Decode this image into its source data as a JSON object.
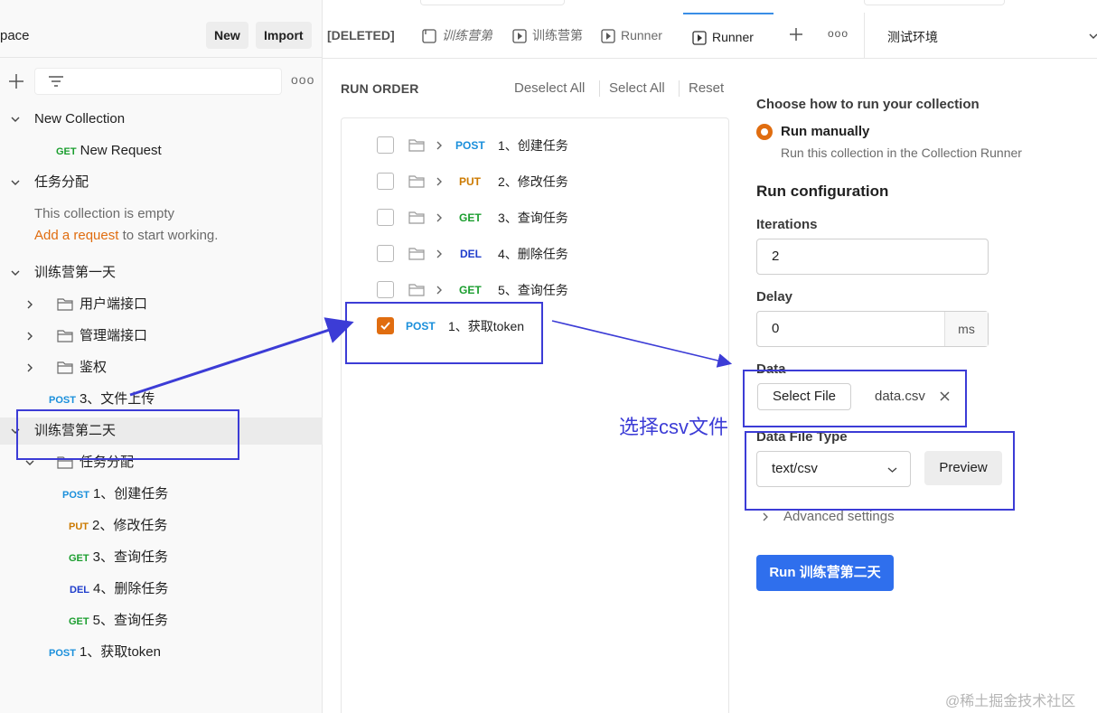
{
  "sidebar": {
    "workspace_name": "pace",
    "new_label": "New",
    "import_label": "Import",
    "more_label": "ooo",
    "tree": [
      {
        "label": "New Collection"
      },
      {
        "method": "GET",
        "label": "New Request"
      },
      {
        "label": "任务分配"
      },
      {
        "empty_text": "This collection is empty",
        "add_link": "Add a request",
        "add_rest": " to start working."
      },
      {
        "label": "训练营第一天"
      },
      {
        "label": "用户端接口"
      },
      {
        "label": "管理端接口"
      },
      {
        "label": "鉴权"
      },
      {
        "method": "POST",
        "label": "3、文件上传"
      },
      {
        "label": "训练营第二天"
      },
      {
        "label": "任务分配"
      },
      {
        "method": "POST",
        "label": "1、创建任务"
      },
      {
        "method": "PUT",
        "label": "2、修改任务"
      },
      {
        "method": "GET",
        "label": "3、查询任务"
      },
      {
        "method": "DEL",
        "label": "4、删除任务"
      },
      {
        "method": "GET",
        "label": "5、查询任务"
      },
      {
        "method": "POST",
        "label": "1、获取token"
      }
    ]
  },
  "tabs": [
    {
      "label": "[DELETED]"
    },
    {
      "label": "训练营第"
    },
    {
      "label": "训练营第"
    },
    {
      "label": "Runner"
    },
    {
      "label": "Runner"
    }
  ],
  "tab_more_label": "ooo",
  "environment": "测试环境",
  "run_order": {
    "title": "RUN ORDER",
    "deselect_all": "Deselect All",
    "select_all": "Select All",
    "reset": "Reset",
    "items": [
      {
        "method": "POST",
        "label": "1、创建任务",
        "checked": false
      },
      {
        "method": "PUT",
        "label": "2、修改任务",
        "checked": false
      },
      {
        "method": "GET",
        "label": "3、查询任务",
        "checked": false
      },
      {
        "method": "DEL",
        "label": "4、删除任务",
        "checked": false
      },
      {
        "method": "GET",
        "label": "5、查询任务",
        "checked": false
      },
      {
        "method": "POST",
        "label": "1、获取token",
        "checked": true
      }
    ]
  },
  "config": {
    "choose_title": "Choose how to run your collection",
    "run_manually": "Run manually",
    "run_manually_desc": "Run this collection in the Collection Runner",
    "section_title": "Run configuration",
    "iterations_label": "Iterations",
    "iterations_value": "2",
    "delay_label": "Delay",
    "delay_value": "0",
    "delay_unit": "ms",
    "data_label": "Data",
    "select_file": "Select File",
    "file_name": "data.csv",
    "data_file_type_label": "Data File Type",
    "data_file_type_value": "text/csv",
    "preview": "Preview",
    "advanced": "Advanced settings",
    "run_button": "Run 训练营第二天"
  },
  "annotation_text": "选择csv文件",
  "watermark": "@稀土掘金技术社区",
  "colors": {
    "accent_orange": "#e06d10",
    "primary_blue": "#2f6fed",
    "annotation": "#3c3cd6",
    "post": "#1a8fdb",
    "put": "#cc7a00",
    "get": "#1b9e2f",
    "del": "#1f3dcc"
  }
}
